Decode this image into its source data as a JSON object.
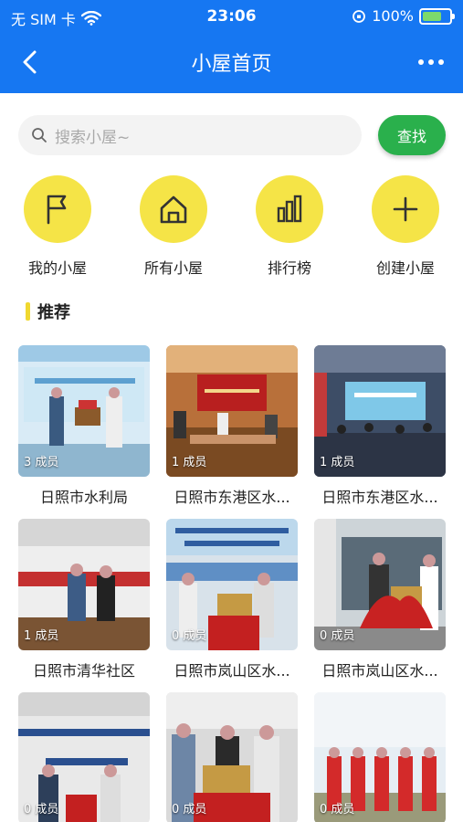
{
  "status_bar": {
    "carrier": "无 SIM 卡",
    "time": "23:06",
    "battery": "100%"
  },
  "nav": {
    "title": "小屋首页"
  },
  "search": {
    "placeholder": "搜索小屋~",
    "button": "查找"
  },
  "quick_actions": [
    {
      "label": "我的小屋",
      "icon": "flag-icon"
    },
    {
      "label": "所有小屋",
      "icon": "home-icon"
    },
    {
      "label": "排行榜",
      "icon": "bar-chart-icon"
    },
    {
      "label": "创建小屋",
      "icon": "plus-icon"
    }
  ],
  "section": {
    "title": "推荐"
  },
  "colors": {
    "brand": "#1677f2",
    "accent_yellow": "#f5e447",
    "green_button": "#2ab04c"
  },
  "cards": [
    {
      "name": "日照市水利局",
      "members": "3 成员"
    },
    {
      "name": "日照市东港区水...",
      "members": "1 成员"
    },
    {
      "name": "日照市东港区水...",
      "members": "1 成员"
    },
    {
      "name": "日照市清华社区",
      "members": "1 成员"
    },
    {
      "name": "日照市岚山区水...",
      "members": "0 成员"
    },
    {
      "name": "日照市岚山区水...",
      "members": "0 成员"
    },
    {
      "name": "",
      "members": "0 成员"
    },
    {
      "name": "",
      "members": "0 成员"
    },
    {
      "name": "",
      "members": "0 成员"
    }
  ]
}
